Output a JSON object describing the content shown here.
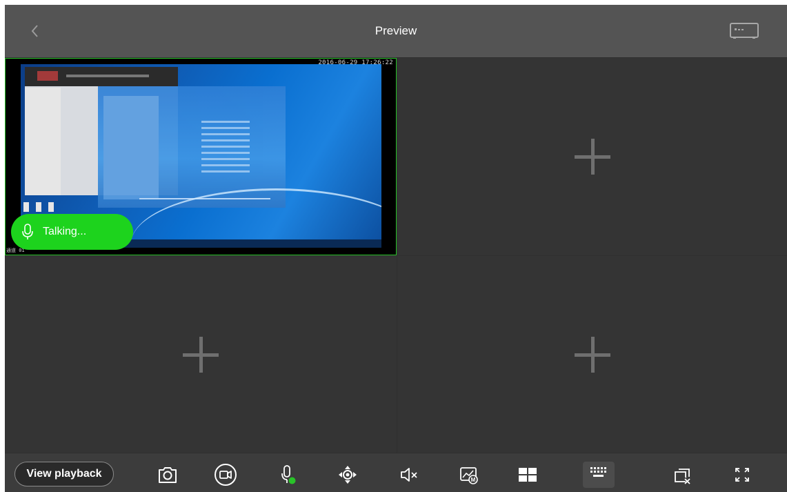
{
  "header": {
    "title": "Preview",
    "back_icon": "chevron-left-icon",
    "device_icon": "nvr-device-icon"
  },
  "grid": {
    "layout": "2x2",
    "selected_channel": 1,
    "active_border_color": "#29c329",
    "channels": [
      {
        "slot": 1,
        "state": "live",
        "timestamp": "2016-06-29 17:26:22",
        "label": "通道 01",
        "talk_status": "Talking..."
      },
      {
        "slot": 2,
        "state": "empty",
        "icon": "add-icon"
      },
      {
        "slot": 3,
        "state": "empty",
        "icon": "add-icon"
      },
      {
        "slot": 4,
        "state": "empty",
        "icon": "add-icon"
      }
    ]
  },
  "talk": {
    "label": "Talking...",
    "color": "#1dd31d",
    "icon": "microphone-icon"
  },
  "toolbar": {
    "playback_label": "View playback",
    "tools": [
      {
        "name": "snapshot",
        "icon": "camera-icon"
      },
      {
        "name": "record",
        "icon": "video-record-icon"
      },
      {
        "name": "talk",
        "icon": "microphone-active-icon",
        "active": true,
        "active_color": "#29c329"
      },
      {
        "name": "ptz",
        "icon": "ptz-direction-icon"
      },
      {
        "name": "audio",
        "icon": "speaker-muted-icon"
      },
      {
        "name": "stream",
        "icon": "stream-quality-icon"
      },
      {
        "name": "split-screen",
        "icon": "grid-layout-icon"
      },
      {
        "name": "keyboard",
        "icon": "keyboard-icon",
        "highlighted": true
      },
      {
        "name": "close-all",
        "icon": "close-all-windows-icon"
      },
      {
        "name": "fullscreen",
        "icon": "fullscreen-icon"
      }
    ]
  }
}
